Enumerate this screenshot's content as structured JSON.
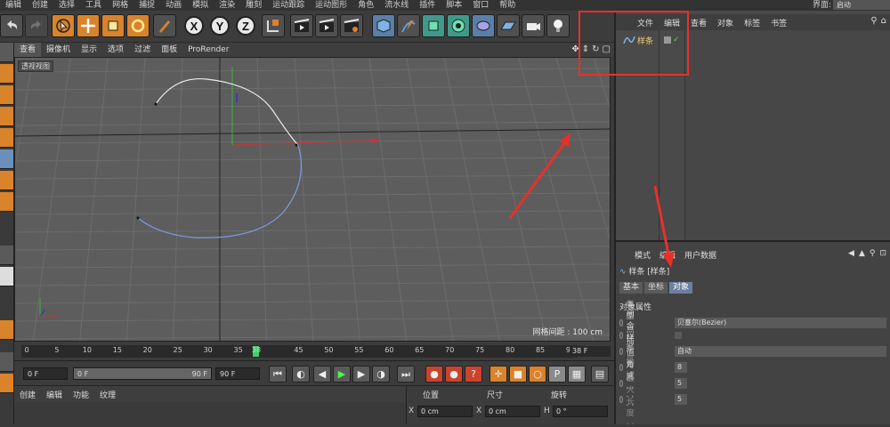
{
  "menubar": {
    "items": [
      "编辑",
      "创建",
      "选择",
      "工具",
      "网格",
      "捕捉",
      "动画",
      "模拟",
      "渲染",
      "雕刻",
      "运动跟踪",
      "运动图形",
      "角色",
      "流水线",
      "插件",
      "脚本",
      "窗口",
      "帮助"
    ],
    "layout_label": "界面:",
    "layout_value": "启动"
  },
  "toolbar": {
    "axis_x": "X",
    "axis_y": "Y",
    "axis_z": "Z"
  },
  "viewport": {
    "menu": [
      "查看",
      "摄像机",
      "显示",
      "选项",
      "过滤",
      "面板",
      "ProRender"
    ],
    "label": "透视视图",
    "grid_spacing": "网格间距 : 100 cm"
  },
  "timeline": {
    "ticks": [
      "0",
      "5",
      "10",
      "15",
      "20",
      "25",
      "30",
      "35",
      "38",
      "45",
      "50",
      "55",
      "60",
      "65",
      "70",
      "75",
      "80",
      "85",
      "90"
    ],
    "current_frame": "38 F"
  },
  "transport": {
    "start": "0 F",
    "range_start": "0 F",
    "range_end": "90 F",
    "end": "90 F"
  },
  "material": {
    "menu": [
      "创建",
      "编辑",
      "功能",
      "纹理"
    ]
  },
  "coords": {
    "headers": [
      "位置",
      "尺寸",
      "旋转"
    ],
    "x_label": "X",
    "x_pos": "0 cm",
    "x_label2": "X",
    "x_size": "0 cm",
    "h_label": "H",
    "h_rot": "0 °"
  },
  "object_manager": {
    "menu": [
      "文件",
      "编辑",
      "查看",
      "对象",
      "标签",
      "书签"
    ],
    "object_name": "样条"
  },
  "attribute_manager": {
    "menu": [
      "模式",
      "编辑",
      "用户数据"
    ],
    "title": "样条 [样条]",
    "tabs": [
      "基本",
      "坐标",
      "对象"
    ],
    "section": "对象属性",
    "props": [
      {
        "label": "类型 . . . . . .",
        "value": "贝塞尔(Bezier)"
      },
      {
        "label": "闭合样条 . .",
        "value": ""
      },
      {
        "label": "点插值方式",
        "value": "自动"
      },
      {
        "label": "数量 . . . . . .",
        "value": "8"
      },
      {
        "label": "角度 . . . . . .",
        "value": "5"
      },
      {
        "label": "最大长度 . .",
        "value": "5"
      }
    ]
  },
  "colors": {
    "accent_orange": "#d9832a",
    "highlight_red": "#e8302a",
    "timeline_marker": "#3fcf6a"
  }
}
